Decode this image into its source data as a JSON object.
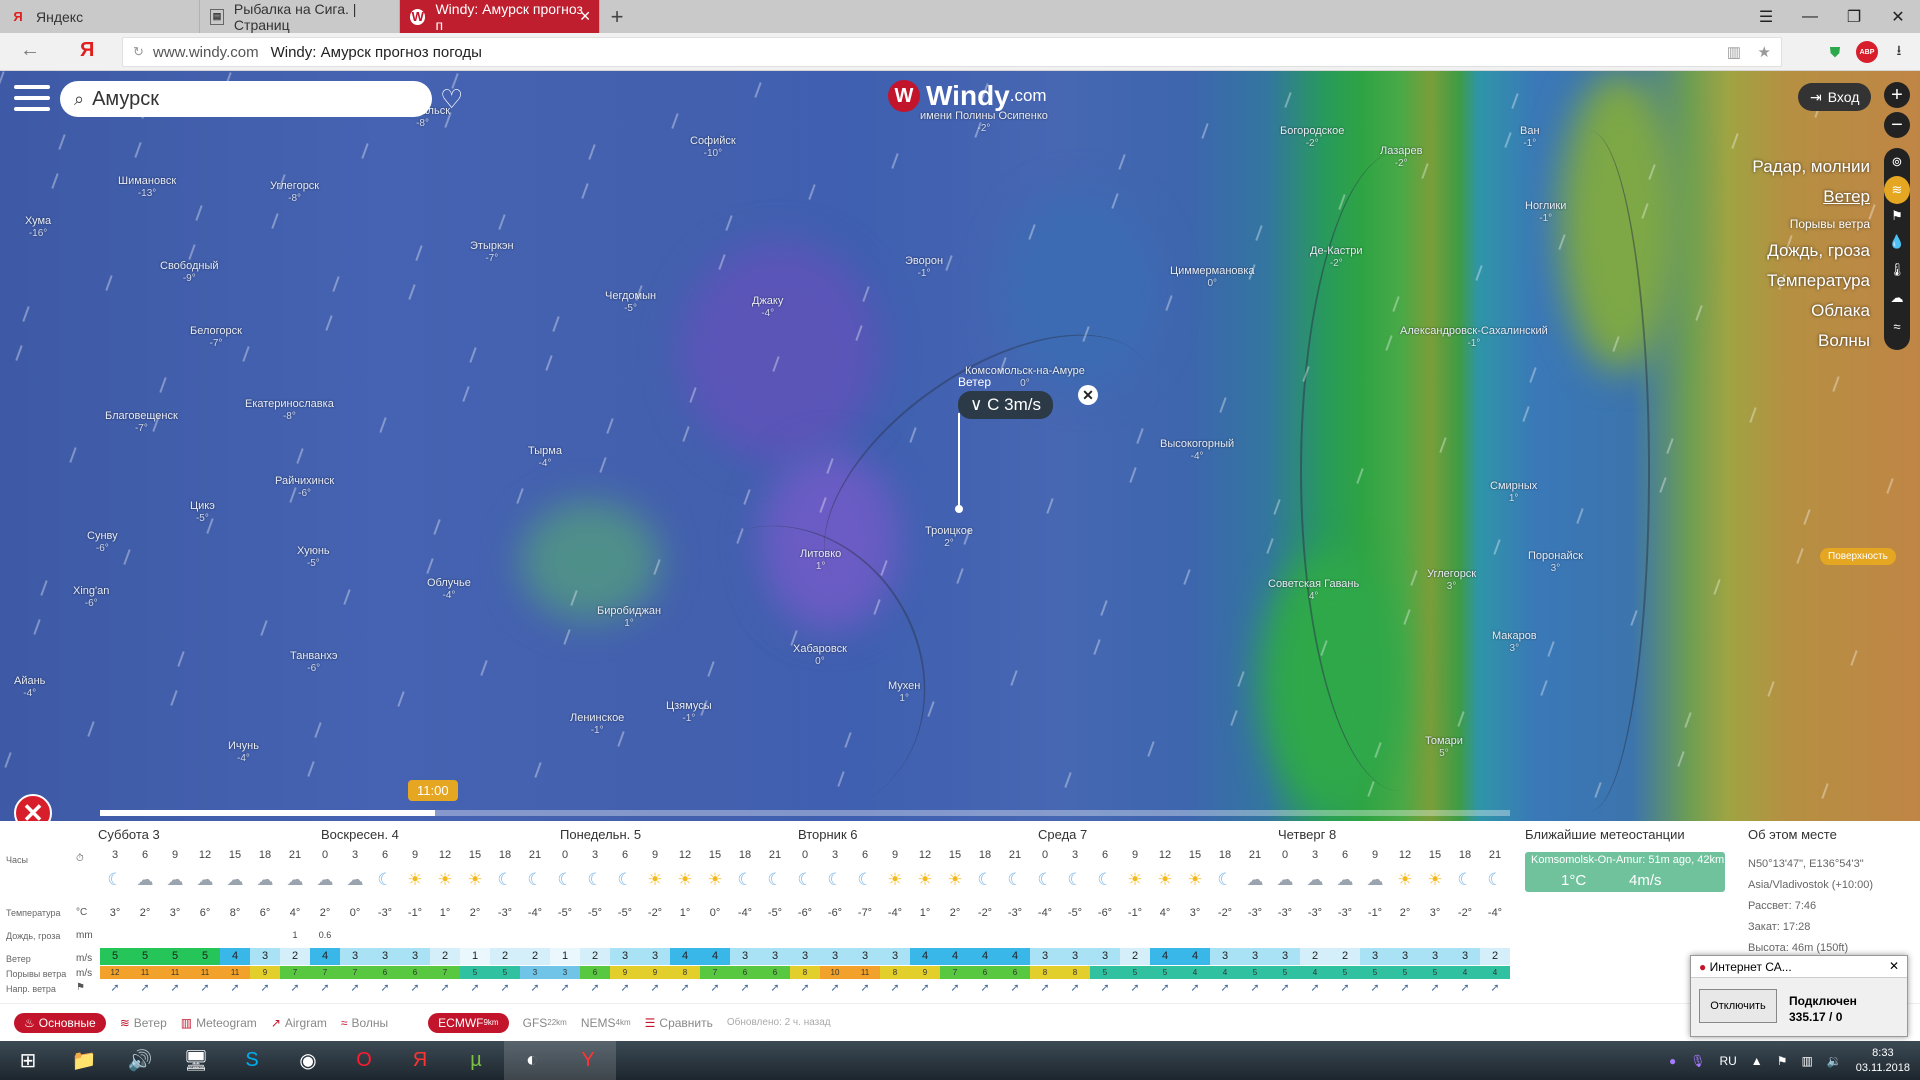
{
  "browser": {
    "tabs": [
      {
        "label": "Яндекс",
        "icon": "yandex-icon",
        "active": false
      },
      {
        "label": "Рыбалка на Сига. | Страниц",
        "icon": "page-icon",
        "active": false
      },
      {
        "label": "Windy: Амурск прогноз п",
        "icon": "windy-icon",
        "active": true
      }
    ],
    "host": "www.windy.com",
    "title": "Windy: Амурск прогноз погоды",
    "abp_label": "ABP"
  },
  "app": {
    "search_value": "Амурск",
    "logo": "Windy",
    "logo_suffix": ".com",
    "login": "Вход",
    "zoom_in": "+",
    "zoom_out": "−",
    "surface": "Поверхность",
    "time_pill": "11:00"
  },
  "layers": [
    {
      "label": "Радар, молнии",
      "icon": "radar-icon",
      "active": false,
      "small": false
    },
    {
      "label": "Ветер",
      "icon": "wind-icon",
      "active": true,
      "small": false
    },
    {
      "label": "Порывы ветра",
      "icon": "flag-icon",
      "active": false,
      "small": true
    },
    {
      "label": "Дождь, гроза",
      "icon": "drop-icon",
      "active": false,
      "small": false
    },
    {
      "label": "Температура",
      "icon": "thermometer-icon",
      "active": false,
      "small": false
    },
    {
      "label": "Облака",
      "icon": "cloud-icon",
      "active": false,
      "small": false
    },
    {
      "label": "Волны",
      "icon": "waves-icon",
      "active": false,
      "small": false
    }
  ],
  "popup": {
    "label": "Ветер",
    "value": "∨ С  3m/s"
  },
  "cities": [
    {
      "name": "Февральск",
      "t": "-8°"
    },
    {
      "name": "Софийск",
      "t": "-10°"
    },
    {
      "name": "имени Полины Осипенко",
      "t": "-2°"
    },
    {
      "name": "Богородское",
      "t": "-2°"
    },
    {
      "name": "Лазарев",
      "t": "-2°"
    },
    {
      "name": "Ван",
      "t": "-1°"
    },
    {
      "name": "Шимановск",
      "t": "-13°"
    },
    {
      "name": "Углегорск",
      "t": "-8°"
    },
    {
      "name": "Хума",
      "t": "-16°"
    },
    {
      "name": "Этыркэн",
      "t": "-7°"
    },
    {
      "name": "Эворон",
      "t": "-1°"
    },
    {
      "name": "Де-Кастри",
      "t": "-2°"
    },
    {
      "name": "Ноглики",
      "t": "-1°"
    },
    {
      "name": "Свободный",
      "t": "-9°"
    },
    {
      "name": "Чегдомын",
      "t": "-5°"
    },
    {
      "name": "Джаку",
      "t": "-4°"
    },
    {
      "name": "Циммермановка",
      "t": "0°"
    },
    {
      "name": "Белогорск",
      "t": "-7°"
    },
    {
      "name": "Александровск-Сахалинский",
      "t": "-1°"
    },
    {
      "name": "Комсомольск-на-Амуре",
      "t": "0°"
    },
    {
      "name": "Благовещенск",
      "t": "-7°"
    },
    {
      "name": "Екатериноcлавка",
      "t": "-8°"
    },
    {
      "name": "Тырма",
      "t": "-4°"
    },
    {
      "name": "Высокогорный",
      "t": "-4°"
    },
    {
      "name": "Райчихинск",
      "t": "-6°"
    },
    {
      "name": "Смирных",
      "t": "1°"
    },
    {
      "name": "Цикэ",
      "t": "-5°"
    },
    {
      "name": "Троицкое",
      "t": "2°"
    },
    {
      "name": "Сунву",
      "t": "-6°"
    },
    {
      "name": "Хуюнь",
      "t": "-5°"
    },
    {
      "name": "Литовко",
      "t": "1°"
    },
    {
      "name": "Поронайск",
      "t": "3°"
    },
    {
      "name": "Облучье",
      "t": "-4°"
    },
    {
      "name": "Советская Гавань",
      "t": "4°"
    },
    {
      "name": "Углегорск",
      "t": "3°"
    },
    {
      "name": "Xing'an",
      "t": "-6°"
    },
    {
      "name": "Биробиджан",
      "t": "1°"
    },
    {
      "name": "Макаров",
      "t": "3°"
    },
    {
      "name": "Танванхэ",
      "t": "-6°"
    },
    {
      "name": "Хабаровск",
      "t": "0°"
    },
    {
      "name": "Цзямусы",
      "t": "-1°"
    },
    {
      "name": "Мухен",
      "t": "1°"
    },
    {
      "name": "Ленинское",
      "t": "-1°"
    },
    {
      "name": "Томари",
      "t": "5°"
    },
    {
      "name": "Ичунь",
      "t": "-4°"
    },
    {
      "name": "Айань",
      "t": "-4°"
    }
  ],
  "forecast": {
    "days": [
      "Суббота 3",
      "Воскресен. 4",
      "Понедельн. 5",
      "Вторник 6",
      "Среда 7",
      "Четверг 8"
    ],
    "labels": {
      "hours": "Часы",
      "temp": "Температура",
      "temp_unit": "°C",
      "rain": "Дождь, гроза",
      "rain_unit": "mm",
      "wind": "Ветер",
      "wind_unit": "m/s",
      "gust": "Порывы ветра",
      "gust_unit": "m/s",
      "dir": "Напр. ветра"
    },
    "hours": [
      "3",
      "6",
      "9",
      "12",
      "15",
      "18",
      "21",
      "0",
      "3",
      "6",
      "9",
      "12",
      "15",
      "18",
      "21",
      "0",
      "3",
      "6",
      "9",
      "12",
      "15",
      "18",
      "21",
      "0",
      "3",
      "6",
      "9",
      "12",
      "15",
      "18",
      "21",
      "0",
      "3",
      "6",
      "9",
      "12",
      "15",
      "18",
      "21",
      "0",
      "3",
      "6",
      "9",
      "12",
      "15",
      "18",
      "21"
    ],
    "temps": [
      "3°",
      "2°",
      "3°",
      "6°",
      "8°",
      "6°",
      "4°",
      "2°",
      "0°",
      "-3°",
      "-1°",
      "1°",
      "2°",
      "-3°",
      "-4°",
      "-5°",
      "-5°",
      "-5°",
      "-2°",
      "1°",
      "0°",
      "-4°",
      "-5°",
      "-6°",
      "-6°",
      "-7°",
      "-4°",
      "1°",
      "2°",
      "-2°",
      "-3°",
      "-4°",
      "-5°",
      "-6°",
      "-1°",
      "4°",
      "3°",
      "-2°",
      "-3°",
      "-3°",
      "-3°",
      "-3°",
      "-1°",
      "2°",
      "3°",
      "-2°",
      "-4°"
    ],
    "symbols": [
      "☾",
      "☁",
      "☁",
      "☁",
      "☁",
      "☁",
      "☁",
      "☁",
      "☁",
      "☾",
      "☀",
      "☀",
      "☀",
      "☾",
      "☾",
      "☾",
      "☾",
      "☾",
      "☀",
      "☀",
      "☀",
      "☾",
      "☾",
      "☾",
      "☾",
      "☾",
      "☀",
      "☀",
      "☀",
      "☾",
      "☾",
      "☾",
      "☾",
      "☾",
      "☀",
      "☀",
      "☀",
      "☾",
      "☁",
      "☁",
      "☁",
      "☁",
      "☁",
      "☀",
      "☀",
      "☾",
      "☾"
    ],
    "rain": [
      {
        "col": 6,
        "v": "1"
      },
      {
        "col": 7,
        "v": "0.6"
      }
    ],
    "wind": [
      "5",
      "5",
      "5",
      "5",
      "4",
      "3",
      "2",
      "4",
      "3",
      "3",
      "3",
      "2",
      "1",
      "2",
      "2",
      "1",
      "2",
      "3",
      "3",
      "4",
      "4",
      "3",
      "3",
      "3",
      "3",
      "3",
      "3",
      "4",
      "4",
      "4",
      "4",
      "3",
      "3",
      "3",
      "2",
      "4",
      "4",
      "3",
      "3",
      "3",
      "2",
      "2",
      "3",
      "3",
      "3",
      "3",
      "2"
    ],
    "gust": [
      "12",
      "11",
      "11",
      "11",
      "11",
      "9",
      "7",
      "7",
      "7",
      "6",
      "6",
      "7",
      "5",
      "5",
      "3",
      "3",
      "6",
      "9",
      "9",
      "8",
      "7",
      "6",
      "6",
      "8",
      "10",
      "11",
      "8",
      "9",
      "7",
      "6",
      "6",
      "8",
      "8",
      "5",
      "5",
      "5",
      "4",
      "4",
      "5",
      "5",
      "4",
      "5",
      "5",
      "5",
      "5",
      "4",
      "4"
    ],
    "dir": "➚"
  },
  "stations": {
    "title": "Ближайшие метеостанции",
    "name": "Komsomolsk-On-Amur: 51m ago, 42km",
    "temp": "1°C",
    "wind": "4m/s"
  },
  "about": {
    "title": "Об этом месте",
    "coords": "N50°13'47\", E136°54'3\"",
    "tz": "Asia/Vladivostok (+10:00)",
    "sunrise": "Рассвет: 7:46",
    "sunset": "Закат: 17:28",
    "height": "Высота: 46m (150ft)"
  },
  "bottombar": [
    {
      "label": "Основные",
      "icon": "basic-icon",
      "active": true
    },
    {
      "label": "Ветер",
      "icon": "wind-icon",
      "active": false
    },
    {
      "label": "Meteogram",
      "icon": "meteogram-icon",
      "active": false
    },
    {
      "label": "Airgram",
      "icon": "airgram-icon",
      "active": false
    },
    {
      "label": "Волны",
      "icon": "waves-icon",
      "active": false
    }
  ],
  "models": [
    {
      "label": "ECMWF",
      "sub": "9km",
      "active": true
    },
    {
      "label": "GFS",
      "sub": "22km",
      "active": false
    },
    {
      "label": "NEMS",
      "sub": "4km",
      "active": false
    }
  ],
  "compare": "Сравнить",
  "updated": "Обновлено: 2 ч. назад",
  "vpn": {
    "title": "Интернет СА...",
    "button": "Отключить",
    "status": "Подключен",
    "traffic": "335.17 / 0"
  },
  "taskbar": {
    "lang": "RU",
    "time": "8:33",
    "date": "03.11.2018"
  },
  "colors": {
    "accent": "#c2142b",
    "highlight": "#e5a622"
  }
}
